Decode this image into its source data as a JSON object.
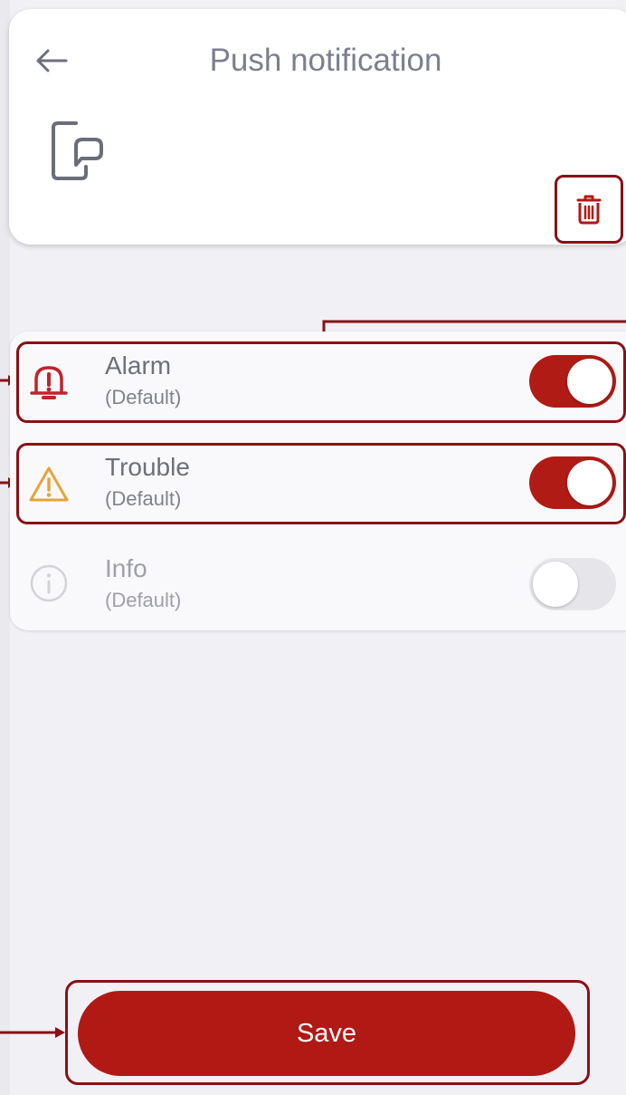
{
  "header": {
    "title": "Push notification",
    "back_icon": "arrow-left-icon",
    "device_icon": "phone-chat-icon",
    "delete_icon": "trash-icon"
  },
  "notifications": [
    {
      "label": "Alarm",
      "sub": "(Default)",
      "icon": "bell-alert-icon",
      "enabled": true,
      "icon_color": "#c0232a"
    },
    {
      "label": "Trouble",
      "sub": "(Default)",
      "icon": "warning-triangle-icon",
      "enabled": true,
      "icon_color": "#e9a23b"
    },
    {
      "label": "Info",
      "sub": "(Default)",
      "icon": "info-circle-icon",
      "enabled": false,
      "icon_color": "#d0d0d6"
    }
  ],
  "actions": {
    "save_label": "Save"
  },
  "colors": {
    "accent": "#b11915",
    "annotation": "#8a1015",
    "background": "#f0f0f5"
  }
}
